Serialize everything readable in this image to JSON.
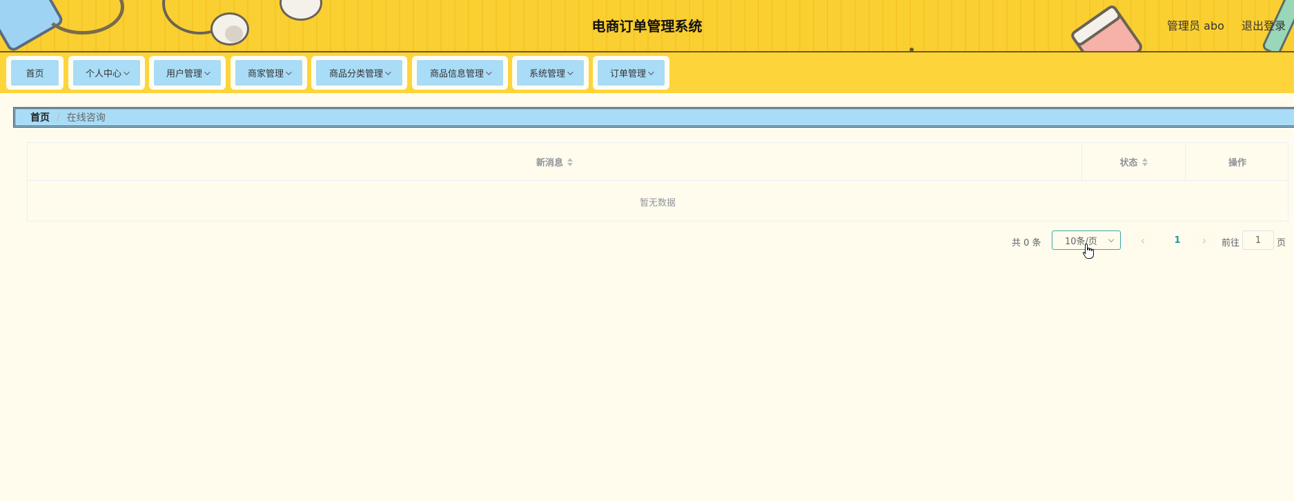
{
  "header": {
    "title": "电商订单管理系统",
    "user_label": "管理员 abo",
    "logout_label": "退出登录"
  },
  "nav": {
    "items": [
      {
        "label": "首页",
        "has_dropdown": false
      },
      {
        "label": "个人中心",
        "has_dropdown": true
      },
      {
        "label": "用户管理",
        "has_dropdown": true
      },
      {
        "label": "商家管理",
        "has_dropdown": true
      },
      {
        "label": "商品分类管理",
        "has_dropdown": true
      },
      {
        "label": "商品信息管理",
        "has_dropdown": true
      },
      {
        "label": "系统管理",
        "has_dropdown": true
      },
      {
        "label": "订单管理",
        "has_dropdown": true
      }
    ]
  },
  "breadcrumb": {
    "home": "首页",
    "separator": "/",
    "current": "在线咨询"
  },
  "table": {
    "columns": [
      "新消息",
      "状态",
      "操作"
    ],
    "empty_text": "暂无数据"
  },
  "pagination": {
    "total_text": "共 0 条",
    "page_size": "10条/页",
    "current_page": "1",
    "goto_label": "前往",
    "goto_value": "1",
    "page_unit": "页"
  },
  "colors": {
    "header_bg": "#f9cf32",
    "nav_bg": "#fdd43a",
    "nav_button": "#a9dcf6",
    "page_bg": "#fffcee",
    "accent": "#1e9a93"
  }
}
